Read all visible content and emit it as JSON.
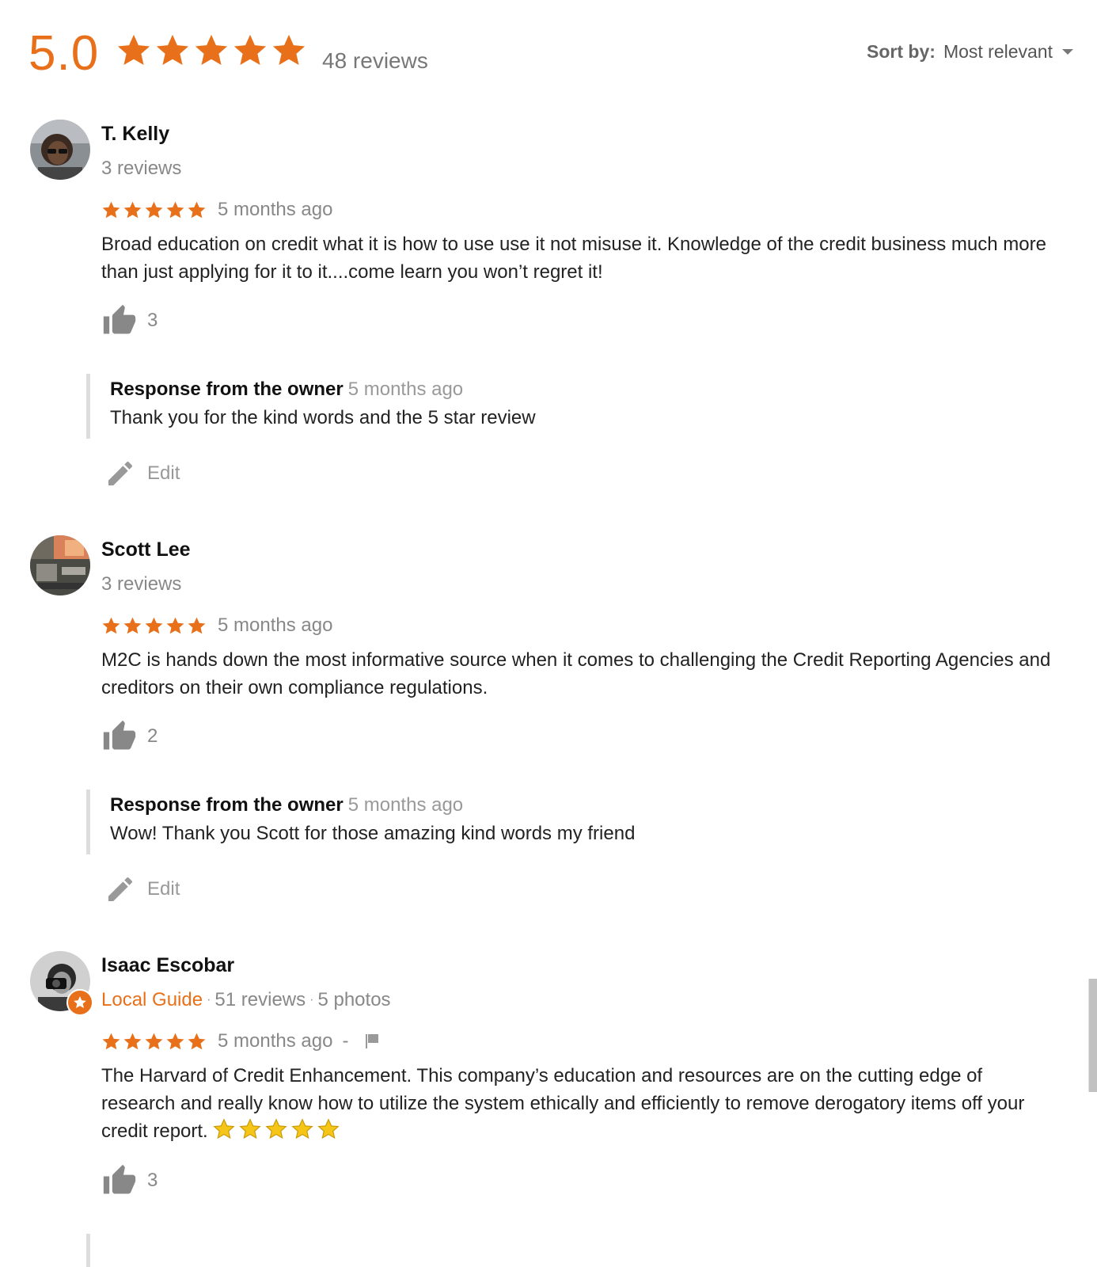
{
  "summary": {
    "score": "5.0",
    "stars": 5,
    "count_label": "48 reviews",
    "sort_label": "Sort by:",
    "sort_value": "Most relevant"
  },
  "colors": {
    "accent": "#e8701a",
    "muted": "#888888",
    "emoji_star": "#f5c518"
  },
  "reviews": [
    {
      "name": "T. Kelly",
      "meta": "3 reviews",
      "stars": 5,
      "time": "5 months ago",
      "text": "Broad education on credit what it is how to use use it not misuse it. Knowledge of the credit business much more than just applying for it to it....come learn you won’t regret it!",
      "likes": "3",
      "owner_title": "Response from the owner",
      "owner_time": "5 months ago",
      "owner_text": "Thank you for the kind words and the 5 star review",
      "edit_label": "Edit"
    },
    {
      "name": "Scott Lee",
      "meta": "3 reviews",
      "stars": 5,
      "time": "5 months ago",
      "text": "M2C is hands down the most informative source when it comes to challenging the Credit Reporting Agencies and creditors on their own compliance regulations.",
      "likes": "2",
      "owner_title": "Response from the owner",
      "owner_time": "5 months ago",
      "owner_text": "Wow! Thank you Scott for those amazing kind words my friend",
      "edit_label": "Edit"
    },
    {
      "name": "Isaac Escobar",
      "local_guide": "Local Guide",
      "reviews_count": "51 reviews",
      "photos_count": "5 photos",
      "stars": 5,
      "time": "5 months ago",
      "dash": "-",
      "text": "The Harvard of Credit Enhancement. This company’s education and resources are on the cutting edge of research and really know how to utilize the system ethically and efficiently to remove derogatory items off your credit report.",
      "emoji_stars": 5,
      "likes": "3"
    }
  ]
}
